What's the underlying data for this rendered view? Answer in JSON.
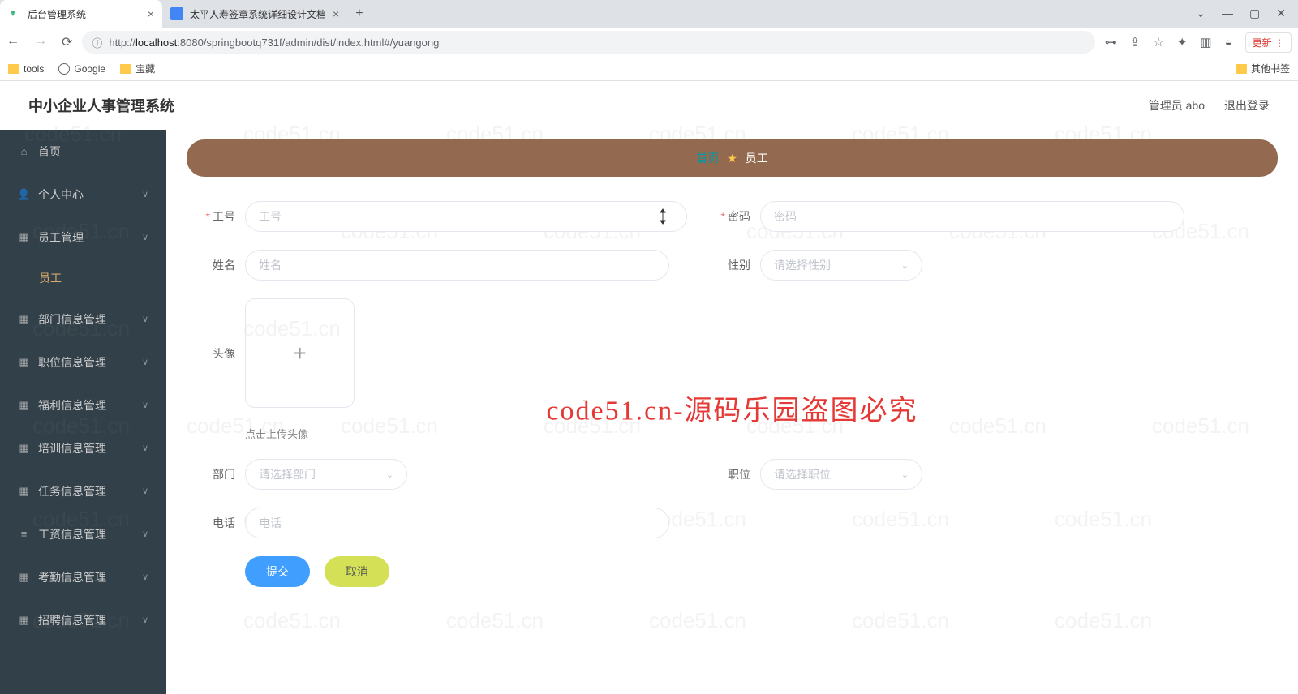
{
  "browser": {
    "tabs": [
      {
        "title": "后台管理系统",
        "active": true
      },
      {
        "title": "太平人寿签章系统详细设计文档",
        "active": false
      }
    ],
    "url_scheme": "http://",
    "url_host": "localhost",
    "url_port": ":8080",
    "url_path": "/springbootq731f/admin/dist/index.html#/yuangong",
    "update_label": "更新",
    "bookmarks": [
      {
        "label": "tools",
        "type": "folder"
      },
      {
        "label": "Google",
        "type": "globe"
      },
      {
        "label": "宝藏",
        "type": "folder"
      }
    ],
    "other_bookmarks": "其他书签"
  },
  "app": {
    "title": "中小企业人事管理系统",
    "admin_label": "管理员 abo",
    "logout": "退出登录"
  },
  "sidebar": {
    "items": [
      {
        "label": "首页"
      },
      {
        "label": "个人中心"
      },
      {
        "label": "员工管理",
        "expanded": true,
        "children": [
          {
            "label": "员工"
          }
        ]
      },
      {
        "label": "部门信息管理"
      },
      {
        "label": "职位信息管理"
      },
      {
        "label": "福利信息管理"
      },
      {
        "label": "培训信息管理"
      },
      {
        "label": "任务信息管理"
      },
      {
        "label": "工资信息管理"
      },
      {
        "label": "考勤信息管理"
      },
      {
        "label": "招聘信息管理"
      }
    ]
  },
  "breadcrumb": {
    "home": "首页",
    "current": "员工"
  },
  "form": {
    "gonghao": {
      "label": "工号",
      "placeholder": "工号",
      "required": true
    },
    "mima": {
      "label": "密码",
      "placeholder": "密码",
      "required": true
    },
    "xingming": {
      "label": "姓名",
      "placeholder": "姓名"
    },
    "xingbie": {
      "label": "性别",
      "placeholder": "请选择性别"
    },
    "touxiang": {
      "label": "头像",
      "hint": "点击上传头像"
    },
    "bumen": {
      "label": "部门",
      "placeholder": "请选择部门"
    },
    "zhiwei": {
      "label": "职位",
      "placeholder": "请选择职位"
    },
    "dianhua": {
      "label": "电话",
      "placeholder": "电话"
    },
    "submit": "提交",
    "cancel": "取消"
  },
  "watermark": "code51.cn-源码乐园盗图必究",
  "wm_small": "code51.cn"
}
